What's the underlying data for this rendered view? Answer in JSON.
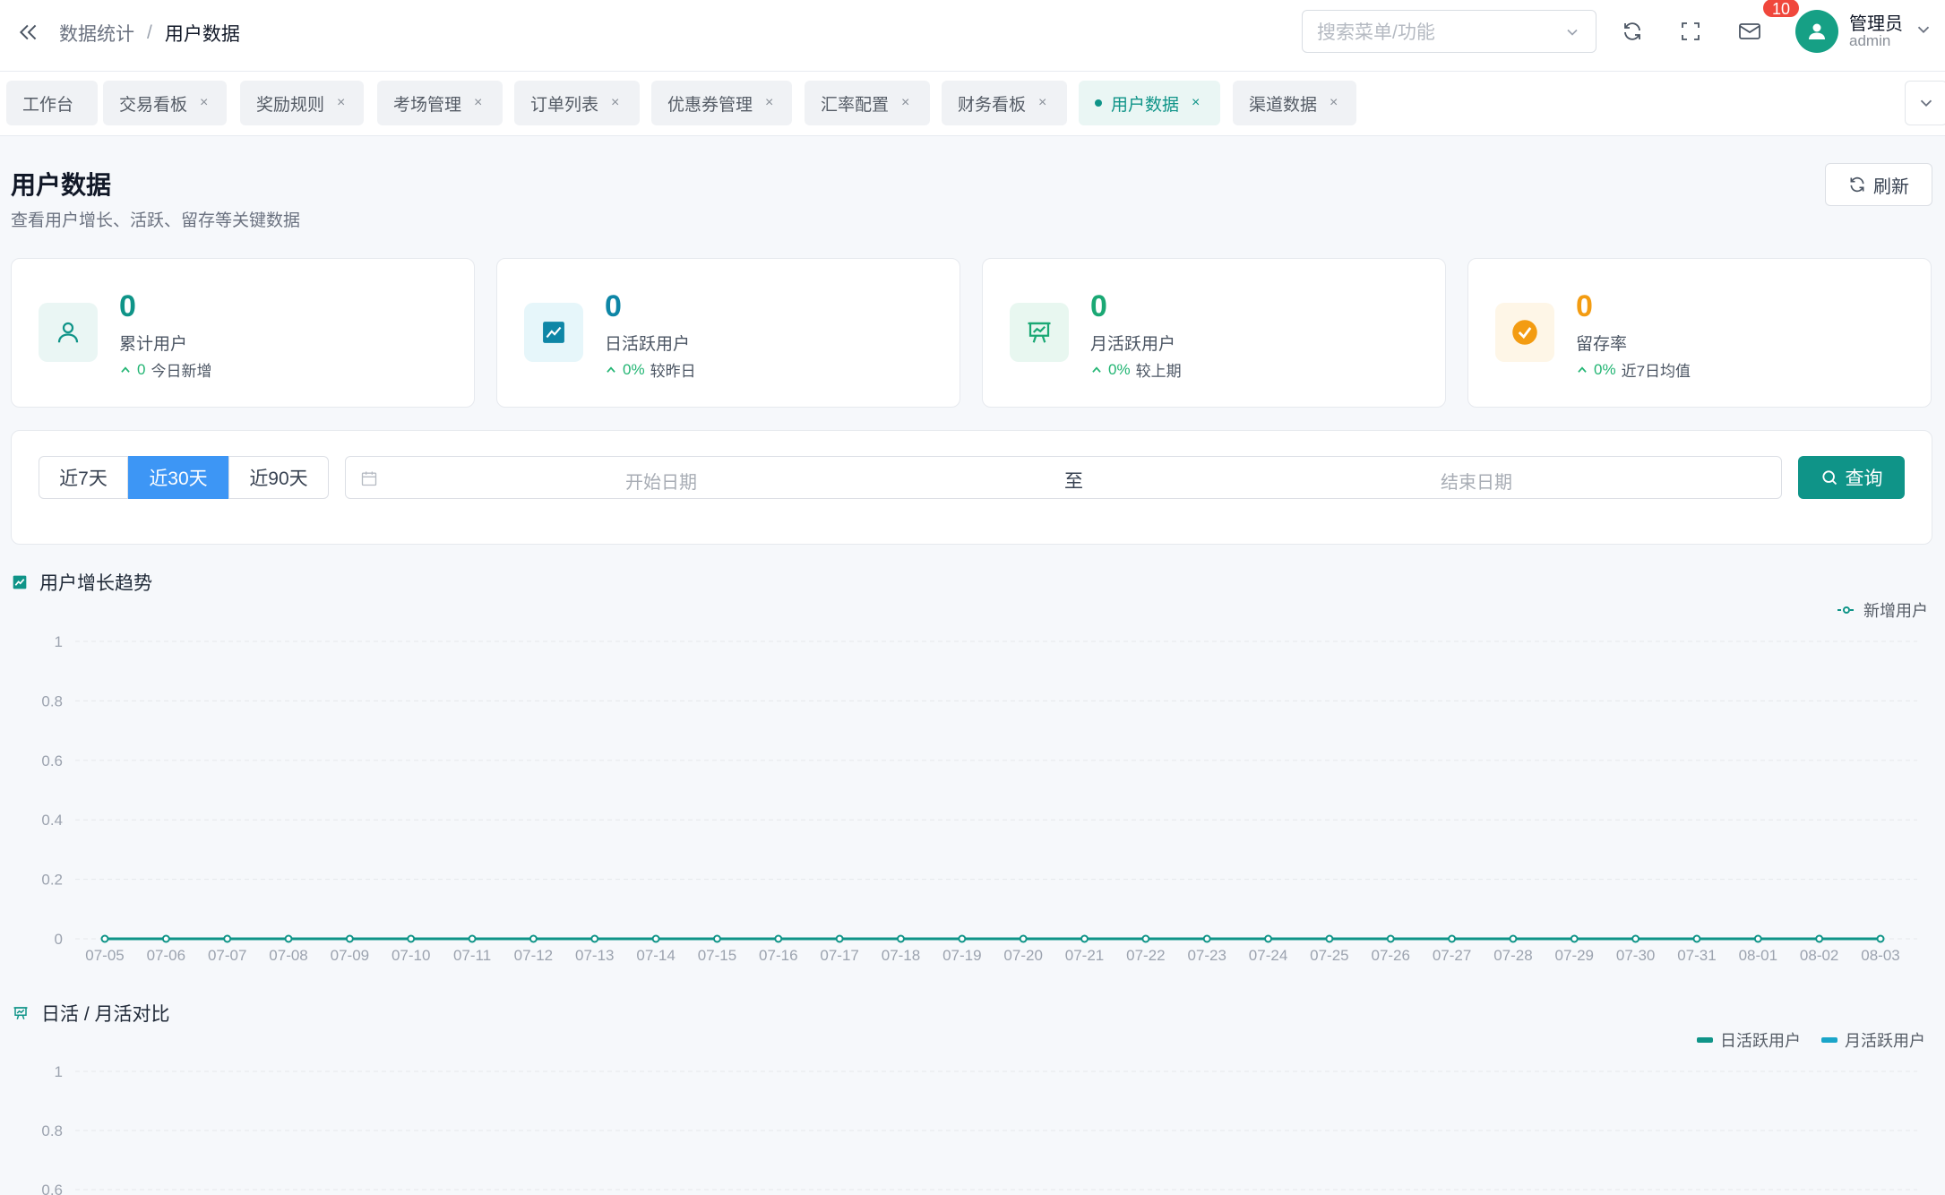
{
  "header": {
    "breadcrumb": [
      "数据统计",
      "用户数据"
    ],
    "breadcrumb_sep": "/",
    "search_placeholder": "搜索菜单/功能",
    "notification_count": "10",
    "user_name": "管理员",
    "user_account": "admin"
  },
  "tabs": [
    {
      "label": "工作台",
      "closable": false,
      "active": false
    },
    {
      "label": "交易看板",
      "closable": true,
      "active": false
    },
    {
      "label": "奖励规则",
      "closable": true,
      "active": false
    },
    {
      "label": "考场管理",
      "closable": true,
      "active": false
    },
    {
      "label": "订单列表",
      "closable": true,
      "active": false
    },
    {
      "label": "优惠券管理",
      "closable": true,
      "active": false
    },
    {
      "label": "汇率配置",
      "closable": true,
      "active": false
    },
    {
      "label": "财务看板",
      "closable": true,
      "active": false
    },
    {
      "label": "用户数据",
      "closable": true,
      "active": true
    },
    {
      "label": "渠道数据",
      "closable": true,
      "active": false
    }
  ],
  "tab_close": "×",
  "page": {
    "title": "用户数据",
    "subtitle": "查看用户增长、活跃、留存等关键数据",
    "refresh_label": "刷新"
  },
  "cards": [
    {
      "value": "0",
      "label": "累计用户",
      "delta": "0",
      "delta_label": "今日新增",
      "color": "#0f9488",
      "icon": "user-icon"
    },
    {
      "value": "0",
      "label": "日活跃用户",
      "delta": "0%",
      "delta_label": "较昨日",
      "color": "#0e86a6",
      "icon": "trend-chart-icon"
    },
    {
      "value": "0",
      "label": "月活跃用户",
      "delta": "0%",
      "delta_label": "较上期",
      "color": "#1aa874",
      "icon": "presentation-icon"
    },
    {
      "value": "0",
      "label": "留存率",
      "delta": "0%",
      "delta_label": "近7日均值",
      "color": "#f39c12",
      "icon": "check-circle-icon"
    }
  ],
  "filter": {
    "ranges": [
      "近7天",
      "近30天",
      "近90天"
    ],
    "active_range": "近30天",
    "start_placeholder": "开始日期",
    "separator": "至",
    "end_placeholder": "结束日期",
    "query_label": "查询"
  },
  "colors": {
    "primary": "#0f9488",
    "blue": "#3d96f5",
    "cyan": "#1aa5c9",
    "badge": "#f0473c"
  },
  "chart_data": [
    {
      "type": "line",
      "title": "用户增长趋势",
      "x": [
        "07-05",
        "07-06",
        "07-07",
        "07-08",
        "07-09",
        "07-10",
        "07-11",
        "07-12",
        "07-13",
        "07-14",
        "07-15",
        "07-16",
        "07-17",
        "07-18",
        "07-19",
        "07-20",
        "07-21",
        "07-22",
        "07-23",
        "07-24",
        "07-25",
        "07-26",
        "07-27",
        "07-28",
        "07-29",
        "07-30",
        "07-31",
        "08-01",
        "08-02",
        "08-03"
      ],
      "series": [
        {
          "name": "新增用户",
          "values": [
            0,
            0,
            0,
            0,
            0,
            0,
            0,
            0,
            0,
            0,
            0,
            0,
            0,
            0,
            0,
            0,
            0,
            0,
            0,
            0,
            0,
            0,
            0,
            0,
            0,
            0,
            0,
            0,
            0,
            0
          ]
        }
      ],
      "yticks": [
        "0",
        "0.2",
        "0.4",
        "0.6",
        "0.8",
        "1"
      ],
      "ylim": [
        0,
        1
      ],
      "legend": "top-right",
      "grid": true
    },
    {
      "type": "bar",
      "title": "日活 / 月活对比",
      "series": [
        {
          "name": "日活跃用户"
        },
        {
          "name": "月活跃用户"
        }
      ],
      "yticks_visible": [
        "1",
        "0.8",
        "0.6"
      ],
      "ylim": [
        0,
        1
      ],
      "legend": "top-right",
      "grid": true
    }
  ]
}
